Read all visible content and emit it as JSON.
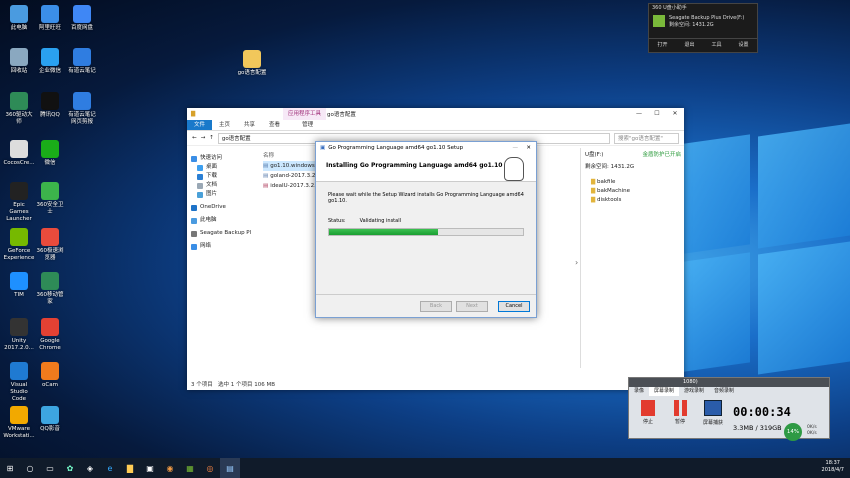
{
  "desktop_icons": [
    {
      "label": "此电脑",
      "icon": "computer-icon",
      "color": "#4a9be0"
    },
    {
      "label": "回收站",
      "icon": "recycle-bin-icon",
      "color": "#8aa8c0"
    },
    {
      "label": "360驱动大师",
      "icon": "360-driver-icon",
      "color": "#2e8b57"
    },
    {
      "label": "CocosCre...",
      "icon": "cocos-icon",
      "color": "#dddddd"
    },
    {
      "label": "Epic Games Launcher",
      "icon": "epic-icon",
      "color": "#222222"
    },
    {
      "label": "GeForce Experience",
      "icon": "geforce-icon",
      "color": "#76b900"
    },
    {
      "label": "TIM",
      "icon": "tim-icon",
      "color": "#1e90ff"
    },
    {
      "label": "Unity 2017.2.0...",
      "icon": "unity-icon",
      "color": "#333333"
    },
    {
      "label": "Visual Studio Code",
      "icon": "vscode-icon",
      "color": "#1f7ad2"
    },
    {
      "label": "VMware Workstati...",
      "icon": "vmware-icon",
      "color": "#f2a900"
    },
    {
      "label": "阿里旺旺",
      "icon": "aliwangwang-icon",
      "color": "#3b8ee8"
    },
    {
      "label": "企业微信",
      "icon": "wecom-icon",
      "color": "#2aa1f0"
    },
    {
      "label": "腾讯QQ",
      "icon": "qq-icon",
      "color": "#111111"
    },
    {
      "label": "微信",
      "icon": "wechat-icon",
      "color": "#1aad19"
    },
    {
      "label": "360安全卫士",
      "icon": "360-security-icon",
      "color": "#3cb44b"
    },
    {
      "label": "360极速浏览器",
      "icon": "360-browser-icon",
      "color": "#e94b3c"
    },
    {
      "label": "360移动管家",
      "icon": "360-mobile-icon",
      "color": "#2e8b57"
    },
    {
      "label": "Google Chrome",
      "icon": "chrome-icon",
      "color": "#e34133"
    },
    {
      "label": "oCam",
      "icon": "ocam-icon",
      "color": "#f07b1d"
    },
    {
      "label": "QQ影音",
      "icon": "qq-player-icon",
      "color": "#3da5e0"
    },
    {
      "label": "百度网盘",
      "icon": "baidu-netdisk-icon",
      "color": "#3f87f5"
    },
    {
      "label": "有道云笔记",
      "icon": "youdao-note-icon",
      "color": "#2f7de1"
    },
    {
      "label": "有道云笔记网页剪报",
      "icon": "youdao-clip-icon",
      "color": "#2f7de1"
    },
    {
      "label": "go语言配置",
      "icon": "folder-icon",
      "color": "#f1c75b"
    }
  ],
  "explorer": {
    "ribbon_tabs": [
      "文件",
      "主页",
      "共享",
      "查看",
      "管理"
    ],
    "context_tab": "应用程序工具",
    "window_title": "go语言配置",
    "address": "go语言配置",
    "search_placeholder": "搜索\"go语言配置\"",
    "nav_items": [
      "快速访问",
      "桌面",
      "下载",
      "文档",
      "图片",
      "OneDrive",
      "此电脑",
      "Seagate Backup Pl",
      "网络"
    ],
    "list_header": "名称",
    "files": [
      "go1.10.windows...",
      "goland-2017.3.2...",
      "ideaIU-2017.3.2.win..."
    ],
    "status_left": "3 个项目",
    "status_sel": "选中 1 个项目  106 MB"
  },
  "right_pane": {
    "drive": "U盘(F:)",
    "badge": "金盾防护已开启",
    "free": "剩余空间: 1431.2G",
    "folders": [
      "bakfile",
      "bakMachine",
      "disktools"
    ]
  },
  "installer": {
    "title": "Go Programming Language amd64 go1.10 Setup",
    "heading": "Installing Go Programming Language amd64 go1.10",
    "message": "Please wait while the Setup Wizard installs Go Programming Language amd64 go1.10.",
    "status_label": "Status:",
    "status_value": "Validating install",
    "progress": 0.56,
    "back": "Back",
    "next": "Next",
    "cancel": "Cancel"
  },
  "recorder": {
    "title": "1080)",
    "tabs": [
      "录像",
      "屏幕录制",
      "游戏录制",
      "音频录制"
    ],
    "stop": "停止",
    "pause": "暂停",
    "capture": "屏幕捕获",
    "time": "00:00:34",
    "size": "3.3MB / 319GB",
    "cpu": "14%",
    "net_up": "0K/s",
    "net_down": "0K/s"
  },
  "seagate_popup": {
    "title": "360 U盘小助手",
    "drive": "Seagate Backup Plus Drive(F:)",
    "free": "剩余空间: 1431.2G",
    "actions": [
      "打开",
      "退出",
      "工具",
      "设置"
    ]
  },
  "taskbar": {
    "time": "18:37",
    "date": "2018/4/7"
  }
}
